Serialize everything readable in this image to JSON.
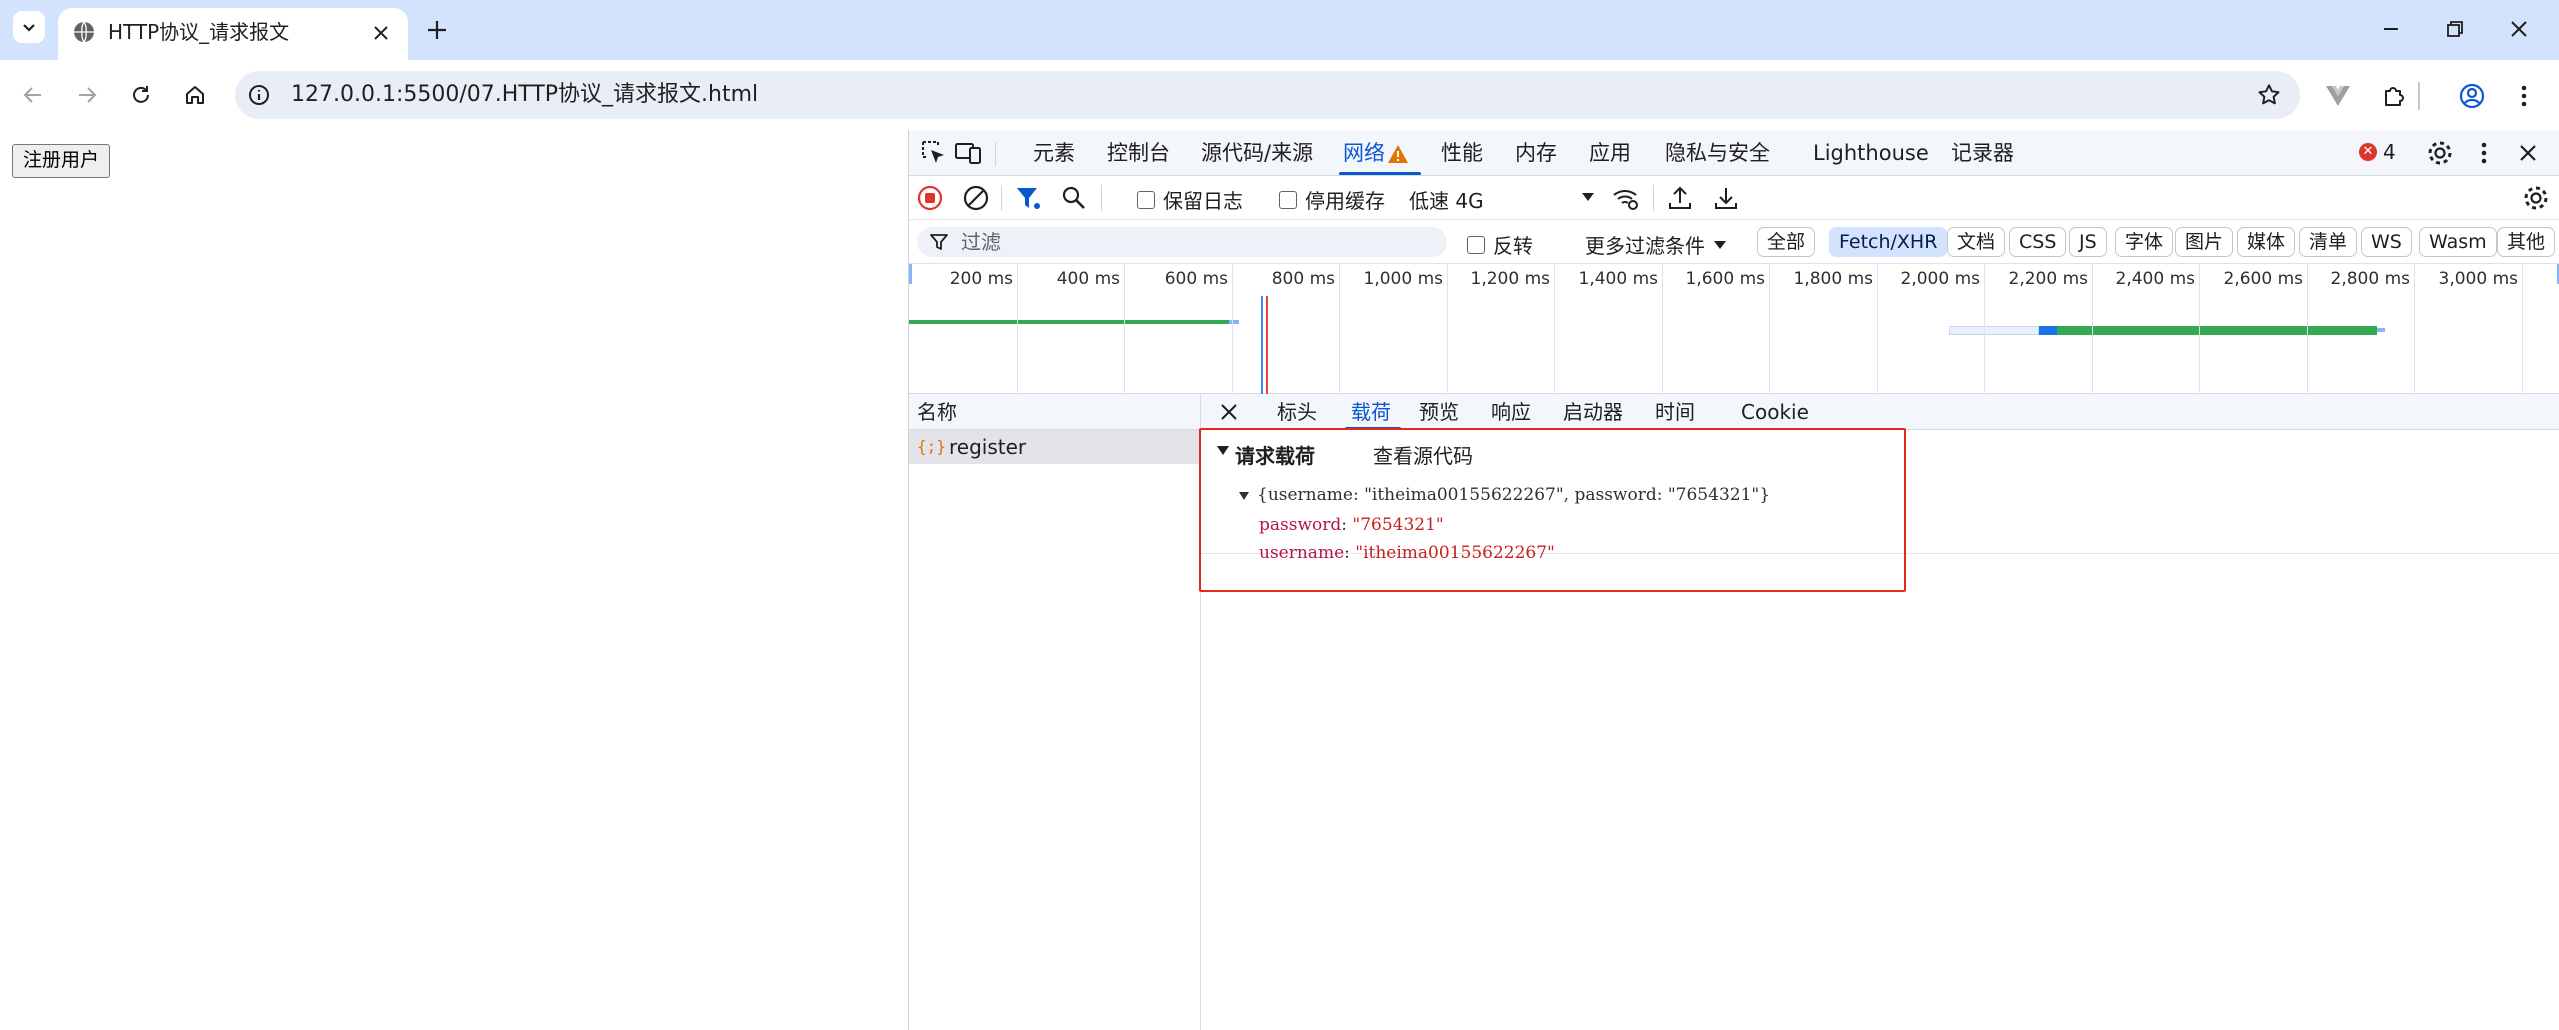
{
  "browser": {
    "tab_title": "HTTP协议_请求报文",
    "url": "127.0.0.1:5500/07.HTTP协议_请求报文.html"
  },
  "page": {
    "register_button": "注册用户"
  },
  "devtools": {
    "tabs": [
      "元素",
      "控制台",
      "源代码/来源",
      "网络",
      "性能",
      "内存",
      "应用",
      "隐私与安全",
      "Lighthouse",
      "记录器"
    ],
    "active_tab": "网络",
    "error_count": "4",
    "controls": {
      "preserve_log": "保留日志",
      "disable_cache": "停用缓存",
      "throttle": "低速 4G"
    },
    "filter": {
      "placeholder": "过滤",
      "invert": "反转",
      "more_filters": "更多过滤条件",
      "chips": [
        "全部",
        "Fetch/XHR",
        "文档",
        "CSS",
        "JS",
        "字体",
        "图片",
        "媒体",
        "清单",
        "WS",
        "Wasm",
        "其他"
      ],
      "active_chip": "Fetch/XHR"
    },
    "timeline_ticks": [
      "200 ms",
      "400 ms",
      "600 ms",
      "800 ms",
      "1,000 ms",
      "1,200 ms",
      "1,400 ms",
      "1,600 ms",
      "1,800 ms",
      "2,000 ms",
      "2,200 ms",
      "2,400 ms",
      "2,600 ms",
      "2,800 ms",
      "3,000 ms"
    ],
    "name_header": "名称",
    "request_name": "register",
    "request_icon": "{;}",
    "detail_tabs": [
      "标头",
      "载荷",
      "预览",
      "响应",
      "启动器",
      "时间",
      "Cookie"
    ],
    "active_detail_tab": "载荷",
    "payload": {
      "section_title": "请求载荷",
      "view_source": "查看源代码",
      "summary": "{username: \"itheima00155622267\", password: \"7654321\"}",
      "fields": [
        {
          "key": "password",
          "value": "\"7654321\""
        },
        {
          "key": "username",
          "value": "\"itheima00155622267\""
        }
      ]
    }
  },
  "colors": {
    "accent": "#0b57d0",
    "highlight_box": "#e8261c",
    "error": "#dc362e"
  }
}
